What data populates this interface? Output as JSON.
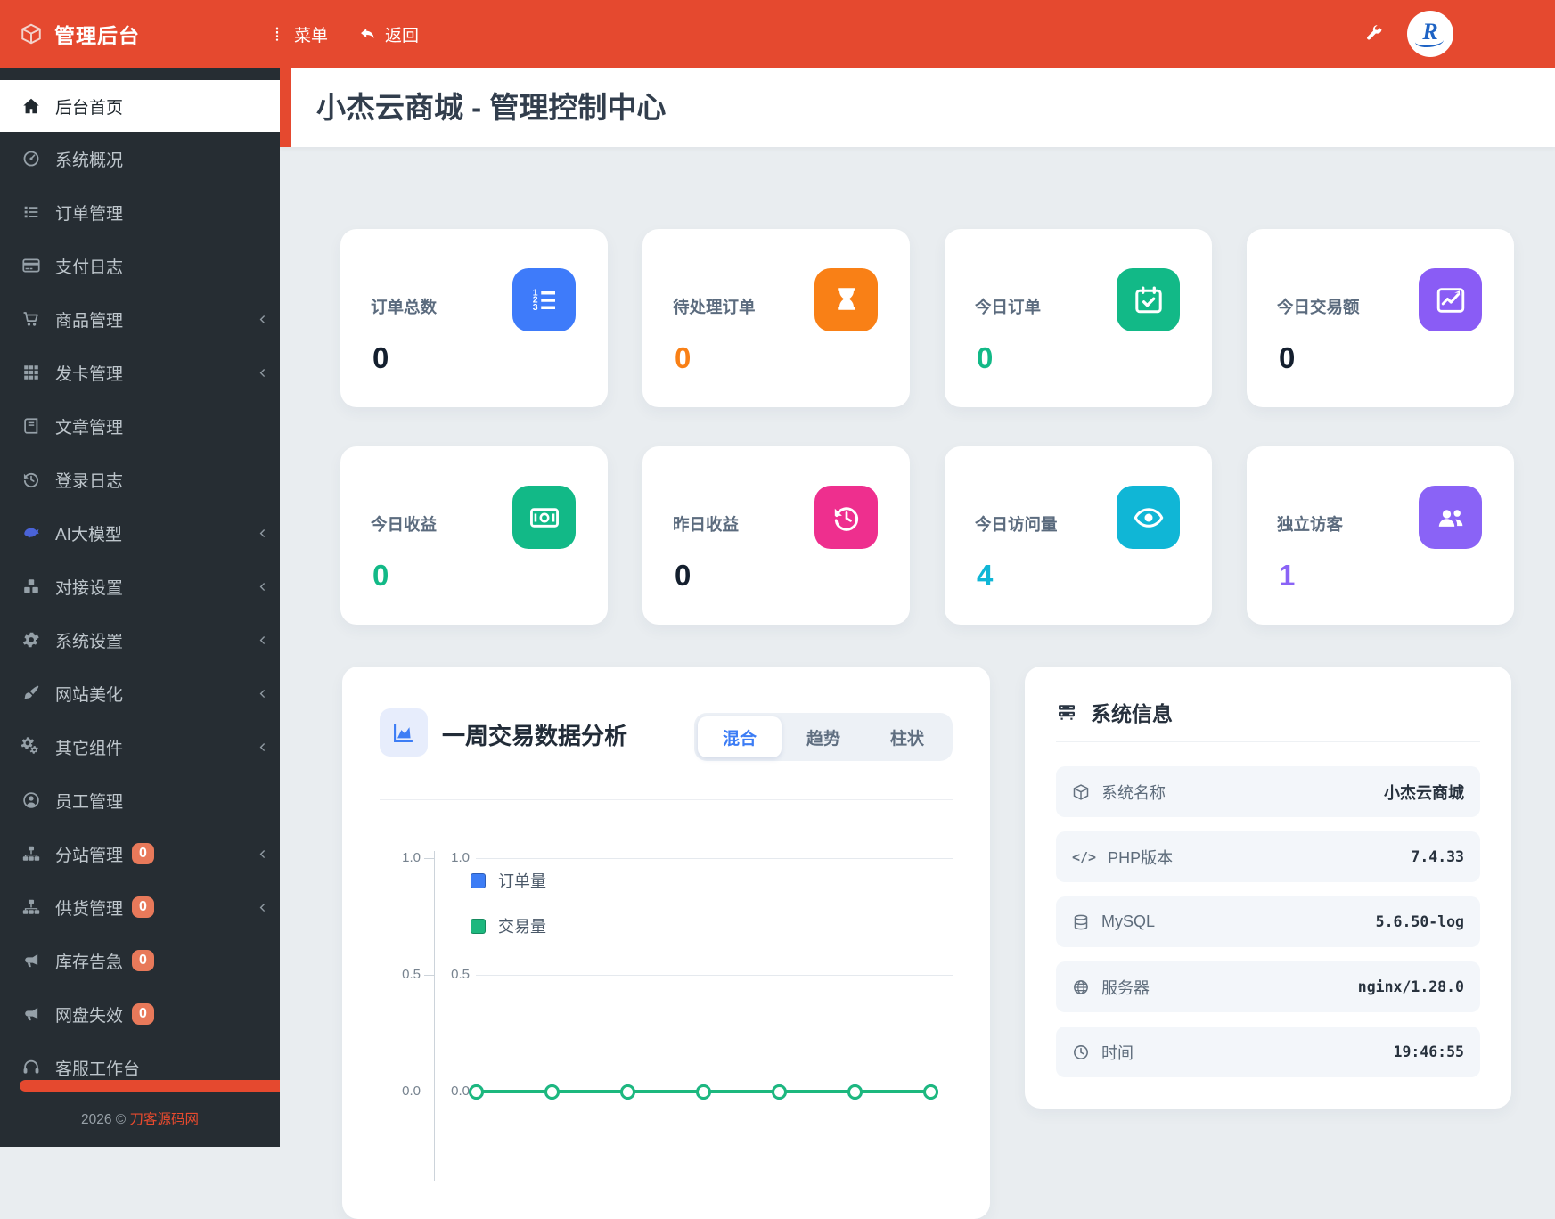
{
  "theme": {
    "navbar_red": "#e5492f",
    "sidebar_bg": "#262d33",
    "content_bg": "#e9edf0",
    "badge_orange": "#e8795a",
    "link_red": "#e84a2e",
    "chart_blue": "#3d7df5",
    "chart_green": "#1db87e"
  },
  "navbar": {
    "brand": "管理后台",
    "menu_label": "菜单",
    "back_label": "返回",
    "avatar_letter": "R"
  },
  "sidebar": {
    "items": [
      {
        "label": "后台首页",
        "icon": "home",
        "active": true
      },
      {
        "label": "系统概况",
        "icon": "gauge"
      },
      {
        "label": "订单管理",
        "icon": "list"
      },
      {
        "label": "支付日志",
        "icon": "credit-card"
      },
      {
        "label": "商品管理",
        "icon": "cart",
        "children": true
      },
      {
        "label": "发卡管理",
        "icon": "grid",
        "children": true
      },
      {
        "label": "文章管理",
        "icon": "book"
      },
      {
        "label": "登录日志",
        "icon": "history"
      },
      {
        "label": "AI大模型",
        "icon": "whale",
        "icon_color": "#4a63d8",
        "children": true
      },
      {
        "label": "对接设置",
        "icon": "cubes",
        "children": true
      },
      {
        "label": "系统设置",
        "icon": "cog",
        "children": true
      },
      {
        "label": "网站美化",
        "icon": "brush",
        "children": true
      },
      {
        "label": "其它组件",
        "icon": "cogs",
        "children": true
      },
      {
        "label": "员工管理",
        "icon": "user-circle"
      },
      {
        "label": "分站管理",
        "icon": "sitemap",
        "badge": "0",
        "children": true
      },
      {
        "label": "供货管理",
        "icon": "sitemap",
        "badge": "0",
        "children": true
      },
      {
        "label": "库存告急",
        "icon": "bullhorn",
        "badge": "0"
      },
      {
        "label": "网盘失效",
        "icon": "bullhorn",
        "badge": "0"
      },
      {
        "label": "客服工作台",
        "icon": "headset"
      }
    ],
    "footer_prefix": "2026 ©",
    "footer_link": "刀客源码网"
  },
  "page": {
    "title": "小杰云商城 - 管理控制中心"
  },
  "stat_cards": [
    {
      "label": "订单总数",
      "value": "0",
      "icon": "list-ol",
      "accent": "#3e7bfa",
      "value_color": "#141f2e"
    },
    {
      "label": "待处理订单",
      "value": "0",
      "icon": "hourglass",
      "accent": "#f98016",
      "value_color": "#f98016"
    },
    {
      "label": "今日订单",
      "value": "0",
      "icon": "calendar-check",
      "accent": "#12b987",
      "value_color": "#12b987"
    },
    {
      "label": "今日交易额",
      "value": "0",
      "icon": "chart-line",
      "accent": "#8a5cf5",
      "value_color": "#141f2e"
    },
    {
      "label": "今日收益",
      "value": "0",
      "icon": "money-bill",
      "accent": "#12b987",
      "value_color": "#12b987"
    },
    {
      "label": "昨日收益",
      "value": "0",
      "icon": "history",
      "accent": "#ee2f8e",
      "value_color": "#141f2e"
    },
    {
      "label": "今日访问量",
      "value": "4",
      "icon": "eye",
      "accent": "#10b6d6",
      "value_color": "#10b6d6"
    },
    {
      "label": "独立访客",
      "value": "1",
      "icon": "users",
      "accent": "#8a63f6",
      "value_color": "#8a63f6"
    }
  ],
  "chart_card": {
    "title": "一周交易数据分析",
    "tabs": [
      {
        "label": "混合",
        "active": true
      },
      {
        "label": "趋势",
        "active": false
      },
      {
        "label": "柱状",
        "active": false
      }
    ]
  },
  "chart_data": {
    "type": "line",
    "title": "一周交易数据分析",
    "series": [
      {
        "name": "订单量",
        "color": "#3d7df5",
        "values": [
          0,
          0,
          0,
          0,
          0,
          0,
          0
        ]
      },
      {
        "name": "交易量",
        "color": "#1db87e",
        "values": [
          0,
          0,
          0,
          0,
          0,
          0,
          0
        ]
      }
    ],
    "y_axis_left_ticks": [
      "1.0",
      "0.5",
      "0.0"
    ],
    "y_axis_inner_ticks": [
      "1.0",
      "0.5",
      "0.0"
    ],
    "ylim": [
      0,
      1
    ],
    "x_tick_labels_visible": false,
    "legend_position": "top-left",
    "grid": true
  },
  "system_info": {
    "title": "系统信息",
    "rows": [
      {
        "icon": "cube",
        "label": "系统名称",
        "value": "小杰云商城",
        "mono": false
      },
      {
        "icon": "code",
        "label": "PHP版本",
        "value": "7.4.33",
        "mono": true
      },
      {
        "icon": "database",
        "label": "MySQL",
        "value": "5.6.50-log",
        "mono": true
      },
      {
        "icon": "globe",
        "label": "服务器",
        "value": "nginx/1.28.0",
        "mono": true
      },
      {
        "icon": "clock",
        "label": "时间",
        "value": "19:46:55",
        "mono": true
      }
    ]
  }
}
